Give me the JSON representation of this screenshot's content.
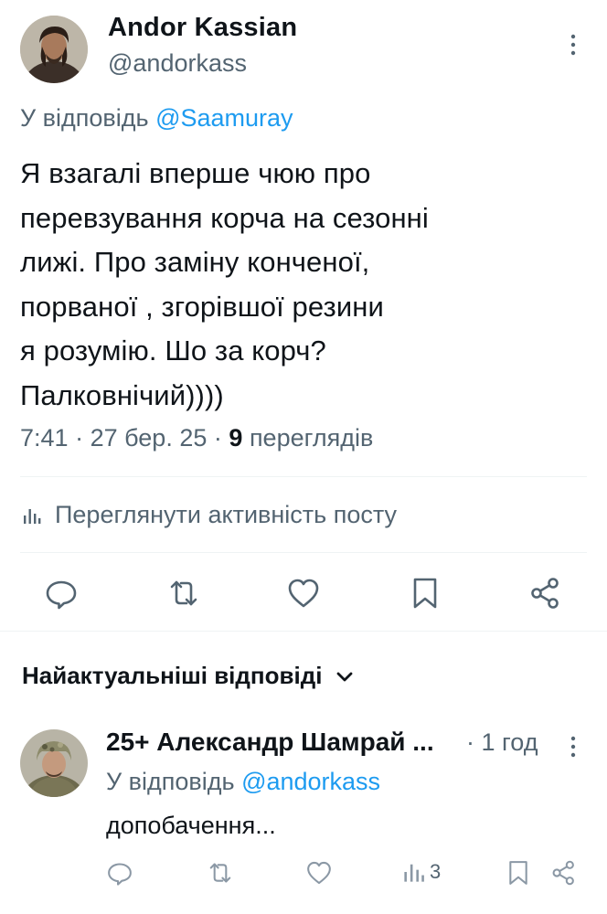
{
  "tweet": {
    "author_name": "Andor Kassian",
    "author_handle": "@andorkass",
    "reply_prefix": "У відповідь",
    "reply_mention": "@Saamuray",
    "text": "Я взагалі вперше чюю про\nперевзування корча на сезонні\nлижі. Про заміну конченої,\nпорваної , згорівшої резини\nя розумію. Шо за корч?\nПалковнічий))))",
    "time": "7:41",
    "date": "27 бер. 25",
    "views_count": "9",
    "views_label": "переглядів",
    "sep": "·"
  },
  "activity_label": "Переглянути активність посту",
  "replies_sort_label": "Найактуальніші відповіді",
  "reply": {
    "author_name": "25+ Александр Шамрай ...",
    "time": "· 1 год",
    "reply_prefix": "У відповідь",
    "reply_mention": "@andorkass",
    "text": "допобачення...",
    "views": "3"
  },
  "colors": {
    "text": "#0f1419",
    "secondary": "#536471",
    "link": "#1d9bf0",
    "divider": "#eff3f4"
  },
  "icons": [
    "more-vertical-icon",
    "analytics-icon",
    "reply-icon",
    "retweet-icon",
    "like-icon",
    "bookmark-icon",
    "share-icon",
    "chevron-down-icon"
  ]
}
